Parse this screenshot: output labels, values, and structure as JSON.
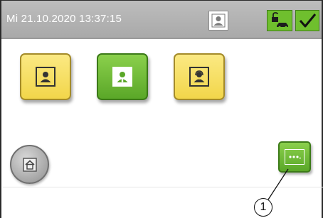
{
  "statusbar": {
    "datetime": "Mi 21.10.2020  13:37:15",
    "user_icon": "user-icon",
    "lock_icon": "unlock-car-icon",
    "check_icon": "check-icon",
    "accent": "#6fbf2e"
  },
  "tiles": [
    {
      "icon": "user-icon",
      "color": "yellow"
    },
    {
      "icon": "user-tie-icon",
      "color": "green"
    },
    {
      "icon": "user-headset-icon",
      "color": "yellow"
    }
  ],
  "buttons": {
    "home_icon": "home-icon",
    "more_icon": "more-dots-icon"
  },
  "callout": {
    "label": "1"
  }
}
